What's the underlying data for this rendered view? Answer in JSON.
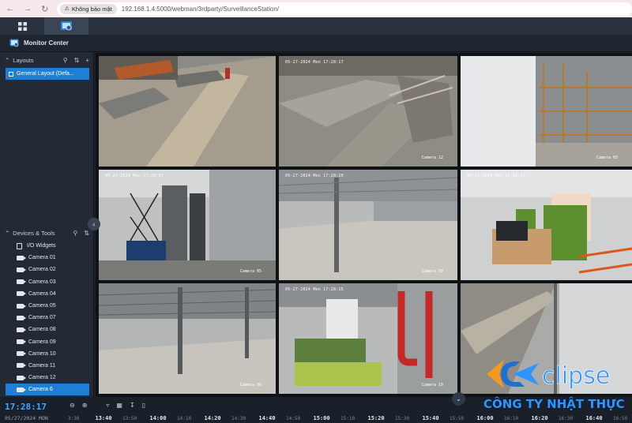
{
  "browser": {
    "security_label": "Không bảo mật",
    "url": "192.168.1.4:5000/webman/3rdparty/SurveillanceStation/"
  },
  "window": {
    "title": "Monitor Center"
  },
  "layouts": {
    "header": "Layouts",
    "items": [
      {
        "label": "General Layout (Defa..."
      }
    ]
  },
  "devices": {
    "header": "Devices & Tools",
    "items": [
      {
        "label": "I/O Widgets",
        "icon": "io-widget-icon"
      },
      {
        "label": "Camera 01"
      },
      {
        "label": "Camera 02"
      },
      {
        "label": "Camera 03"
      },
      {
        "label": "Camera 04"
      },
      {
        "label": "Camera 05"
      },
      {
        "label": "Camera 07"
      },
      {
        "label": "Camera 08"
      },
      {
        "label": "Camera 09"
      },
      {
        "label": "Camera 10"
      },
      {
        "label": "Camera 11"
      },
      {
        "label": "Camera 12"
      },
      {
        "label": "Camera 6",
        "selected": true
      }
    ]
  },
  "feeds": [
    {
      "timestamp": "",
      "name": ""
    },
    {
      "timestamp": "05-27-2024 Mon 17:28:17",
      "name": "Camera 12"
    },
    {
      "timestamp": "",
      "name": "Camera 03"
    },
    {
      "timestamp": "05-27-2024 Mon 17:28:17",
      "name": "Camera 05"
    },
    {
      "timestamp": "05-27-2024 Mon 17:28:20",
      "name": "Camera 08"
    },
    {
      "timestamp": "05-27-2024 Mon 17:28:17",
      "name": ""
    },
    {
      "timestamp": "",
      "name": "Camera 09"
    },
    {
      "timestamp": "05-27-2024 Mon 17:28:15",
      "name": "Camera 10"
    },
    {
      "timestamp": "",
      "name": ""
    }
  ],
  "timeline": {
    "clock": "17:28:17",
    "date": "05/27/2024 MON",
    "ticks": [
      {
        "label": "3:30",
        "major": false
      },
      {
        "label": "13:40",
        "major": true
      },
      {
        "label": "13:50",
        "major": false
      },
      {
        "label": "14:00",
        "major": true
      },
      {
        "label": "14:10",
        "major": false
      },
      {
        "label": "14:20",
        "major": true
      },
      {
        "label": "14:30",
        "major": false
      },
      {
        "label": "14:40",
        "major": true
      },
      {
        "label": "14:50",
        "major": false
      },
      {
        "label": "15:00",
        "major": true
      },
      {
        "label": "15:10",
        "major": false
      },
      {
        "label": "15:20",
        "major": true
      },
      {
        "label": "15:30",
        "major": false
      },
      {
        "label": "15:40",
        "major": true
      },
      {
        "label": "15:50",
        "major": false
      },
      {
        "label": "16:00",
        "major": true
      },
      {
        "label": "16:10",
        "major": false
      },
      {
        "label": "16:20",
        "major": true
      },
      {
        "label": "16:30",
        "major": false
      },
      {
        "label": "16:40",
        "major": true
      },
      {
        "label": "16:50",
        "major": false
      }
    ]
  },
  "watermark": {
    "logo_text": "clipse",
    "company": "CÔNG TY NHẬT THỰC"
  },
  "colors": {
    "accent": "#1f7fd6",
    "clock": "#43a6ff",
    "brand": "#2d95ff",
    "brand_orange": "#f39a1f"
  }
}
